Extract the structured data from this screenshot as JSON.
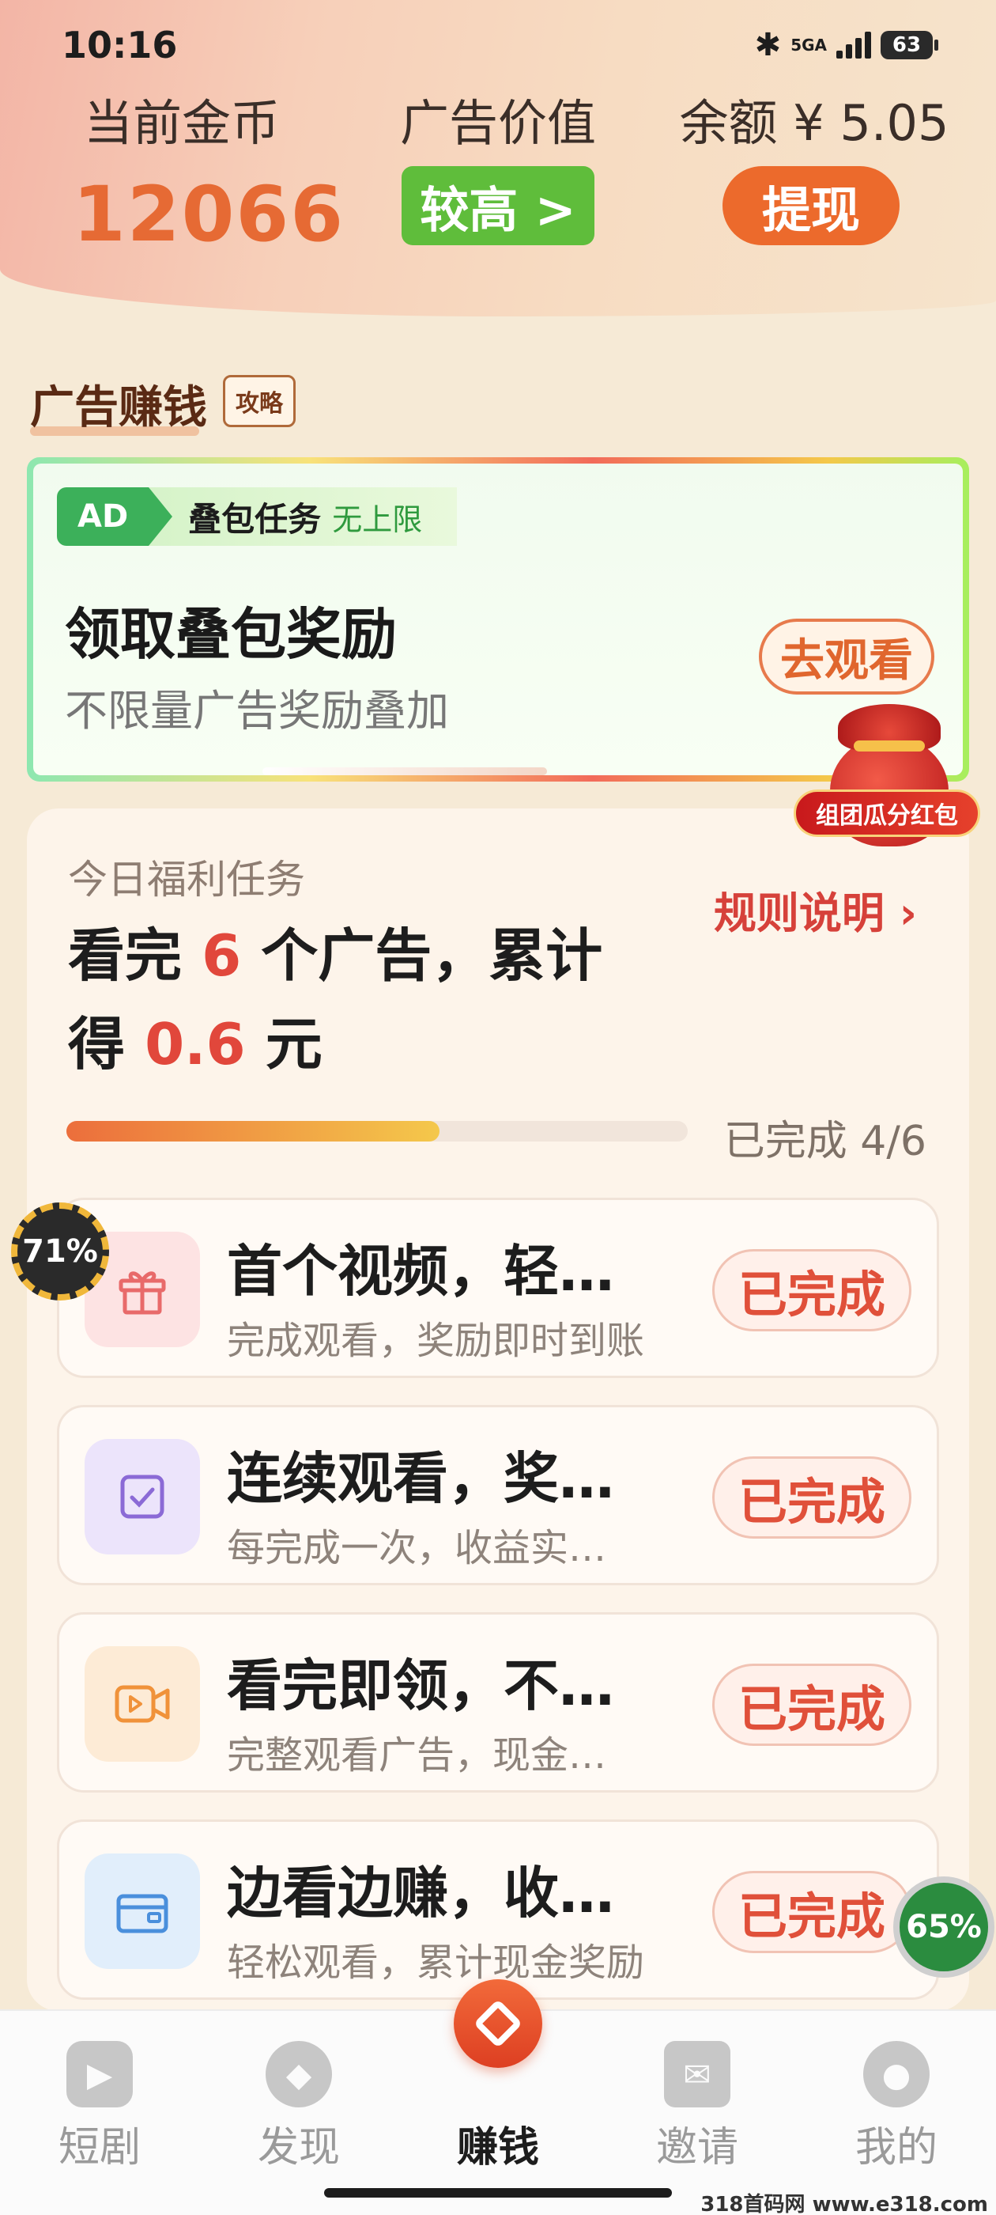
{
  "status": {
    "time": "10:16",
    "network": "5GA",
    "battery": "63"
  },
  "header": {
    "coins_label": "当前金币",
    "coins_value": "12066",
    "ad_value_label": "广告价值",
    "ad_value_button": "较高 >",
    "balance_label": "余额 ¥ 5.05",
    "withdraw_button": "提现"
  },
  "section": {
    "title": "广告赚钱",
    "guide_badge": "攻略"
  },
  "ad_card": {
    "tag": "AD",
    "task_name": "叠包任务",
    "task_limit": "无上限",
    "title": "领取叠包奖励",
    "subtitle": "不限量广告奖励叠加",
    "watch_button": "去观看"
  },
  "redbag": {
    "label": "组团瓜分红包"
  },
  "daily": {
    "heading": "今日福利任务",
    "rules_link": "规则说明 ›",
    "headline_p1": "看完 ",
    "headline_count": "6",
    "headline_p2": " 个广告，累计",
    "headline_p3": "得 ",
    "headline_amount": "0.6",
    "headline_p4": " 元",
    "progress_fraction": 0.6,
    "progress_text": "已完成 4/6"
  },
  "tasks": [
    {
      "title": "首个视频，轻…",
      "desc": "完成观看，奖励即时到账",
      "status": "已完成",
      "icon": "gift-icon",
      "color": "#fde3e3"
    },
    {
      "title": "连续观看，奖…",
      "desc": "每完成一次，收益实…",
      "status": "已完成",
      "icon": "checkbox-icon",
      "color": "#ece4fb"
    },
    {
      "title": "看完即领，不…",
      "desc": "完整观看广告，现金…",
      "status": "已完成",
      "icon": "video-icon",
      "color": "#fdebd6"
    },
    {
      "title": "边看边赚，收…",
      "desc": "轻松观看，累计现金奖励",
      "status": "已完成",
      "icon": "wallet-icon",
      "color": "#e1eefb"
    }
  ],
  "floats": {
    "left_percent": "71%",
    "right_percent": "65%"
  },
  "nav": [
    {
      "label": "短剧",
      "icon": "play-icon"
    },
    {
      "label": "发现",
      "icon": "compass-icon"
    },
    {
      "label": "赚钱",
      "icon": "earn-icon"
    },
    {
      "label": "邀请",
      "icon": "invite-icon"
    },
    {
      "label": "我的",
      "icon": "profile-icon"
    }
  ],
  "watermark": "318首码网 www.e318.com"
}
